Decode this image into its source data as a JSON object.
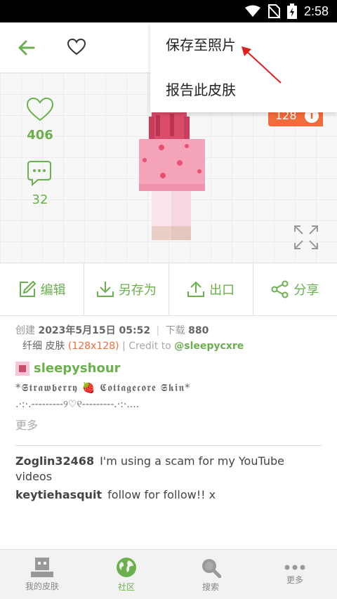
{
  "status_bar": {
    "time": "2:58"
  },
  "menu": {
    "items": [
      "保存至照片",
      "报告此皮肤"
    ]
  },
  "preview": {
    "likes": "406",
    "comments": "32",
    "resolution_badge": "128"
  },
  "actions": {
    "edit": "编辑",
    "save_as": "另存为",
    "export": "出口",
    "share": "分享"
  },
  "info": {
    "created_label": "创建",
    "created_value": "2023年5月15日 05:52",
    "downloads_label": "下载",
    "downloads_value": "880",
    "model": "纤细 皮肤",
    "resolution": "(128x128)",
    "credit_label": "Credit to",
    "credit_user": "@sleepycxre"
  },
  "author": {
    "name": "sleepyshour"
  },
  "description": {
    "line1": "*𝕾𝖙𝖗𝖆𝖜𝖇𝖊𝖗𝖗𝖞 🍓 𝕮𝖔𝖙𝖙𝖆𝖌𝖊𝖈𝖔𝖗𝖊 𝕾𝖐𝖎𝖓*",
    "line2": ".·:·.---------୨♡୧---------.·:·....",
    "more": "更多"
  },
  "comments": [
    {
      "user": "Zoglin32468",
      "text": "I'm using a scam for my YouTube videos"
    },
    {
      "user": "keytiehasquit",
      "text": "follow for follow!! x"
    }
  ],
  "nav": {
    "my_skins": "我的皮肤",
    "community": "社区",
    "search": "搜索",
    "more": "更多"
  },
  "colors": {
    "accent": "#6ab04c",
    "badge": "#f26b3a"
  }
}
